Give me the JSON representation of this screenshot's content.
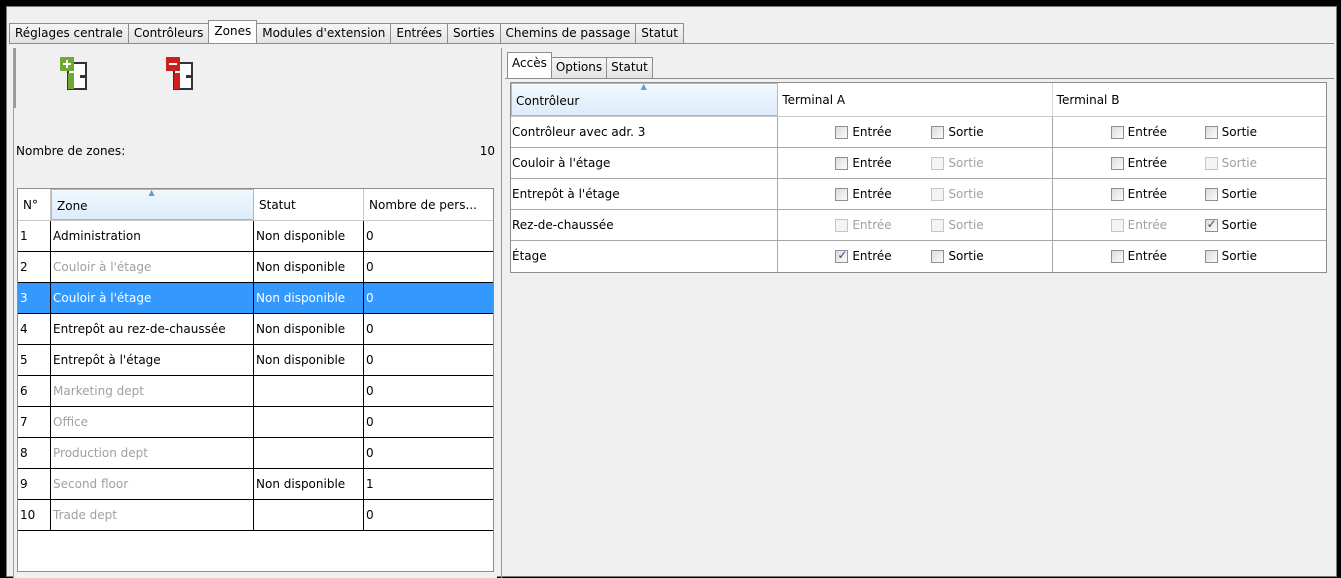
{
  "main_tabs": [
    "Réglages centrale",
    "Contrôleurs",
    "Zones",
    "Modules d'extension",
    "Entrées",
    "Sorties",
    "Chemins de passage",
    "Statut"
  ],
  "main_tabs_active": "Zones",
  "toolbar": {
    "add_icon": "add-zone-icon",
    "remove_icon": "remove-zone-icon",
    "add_color": "#6fa832",
    "remove_color": "#cc1f1f"
  },
  "zone_count": {
    "label": "Nombre de zones:",
    "value": "10"
  },
  "zones_table": {
    "columns": [
      "N°",
      "Zone",
      "Statut",
      "Nombre de pers..."
    ],
    "rows": [
      {
        "num": "1",
        "zone": "Administration",
        "statut": "Non disponible",
        "pers": "0",
        "dim": false,
        "selected": false
      },
      {
        "num": "2",
        "zone": "Couloir à l'étage",
        "statut": "Non disponible",
        "pers": "0",
        "dim": true,
        "selected": false
      },
      {
        "num": "3",
        "zone": "Couloir à l'étage",
        "statut": "Non disponible",
        "pers": "0",
        "dim": false,
        "selected": true
      },
      {
        "num": "4",
        "zone": "Entrepôt au rez-de-chaussée",
        "statut": "Non disponible",
        "pers": "0",
        "dim": false,
        "selected": false
      },
      {
        "num": "5",
        "zone": "Entrepôt à l'étage",
        "statut": "Non disponible",
        "pers": "0",
        "dim": false,
        "selected": false
      },
      {
        "num": "6",
        "zone": "Marketing dept",
        "statut": "",
        "pers": "0",
        "dim": true,
        "selected": false
      },
      {
        "num": "7",
        "zone": "Office",
        "statut": "",
        "pers": "0",
        "dim": true,
        "selected": false
      },
      {
        "num": "8",
        "zone": "Production dept",
        "statut": "",
        "pers": "0",
        "dim": true,
        "selected": false
      },
      {
        "num": "9",
        "zone": "Second floor",
        "statut": "Non disponible",
        "pers": "1",
        "dim": true,
        "selected": false
      },
      {
        "num": "10",
        "zone": "Trade dept",
        "statut": "",
        "pers": "0",
        "dim": true,
        "selected": false
      }
    ],
    "selection_color": "#3399ff"
  },
  "sub_tabs": [
    "Accès",
    "Options",
    "Statut"
  ],
  "sub_tabs_active": "Accès",
  "access_table": {
    "columns": [
      "Contrôleur",
      "Terminal A",
      "Terminal B"
    ],
    "checkbox_labels": {
      "in": "Entrée",
      "out": "Sortie"
    },
    "rows": [
      {
        "name": "Contrôleur avec adr. 3",
        "a_in": {
          "checked": false,
          "enabled": true
        },
        "a_out": {
          "checked": false,
          "enabled": true
        },
        "b_in": {
          "checked": false,
          "enabled": true
        },
        "b_out": {
          "checked": false,
          "enabled": true
        }
      },
      {
        "name": "Couloir à l'étage",
        "a_in": {
          "checked": false,
          "enabled": true
        },
        "a_out": {
          "checked": false,
          "enabled": false
        },
        "b_in": {
          "checked": false,
          "enabled": true
        },
        "b_out": {
          "checked": false,
          "enabled": false
        }
      },
      {
        "name": "Entrepôt à l'étage",
        "a_in": {
          "checked": false,
          "enabled": true
        },
        "a_out": {
          "checked": false,
          "enabled": false
        },
        "b_in": {
          "checked": false,
          "enabled": true
        },
        "b_out": {
          "checked": false,
          "enabled": true
        }
      },
      {
        "name": "Rez-de-chaussée",
        "a_in": {
          "checked": false,
          "enabled": false
        },
        "a_out": {
          "checked": false,
          "enabled": false
        },
        "b_in": {
          "checked": false,
          "enabled": false
        },
        "b_out": {
          "checked": true,
          "enabled": true
        }
      },
      {
        "name": "Étage",
        "a_in": {
          "checked": true,
          "enabled": true
        },
        "a_out": {
          "checked": false,
          "enabled": true
        },
        "b_in": {
          "checked": false,
          "enabled": true
        },
        "b_out": {
          "checked": false,
          "enabled": true
        }
      }
    ]
  }
}
